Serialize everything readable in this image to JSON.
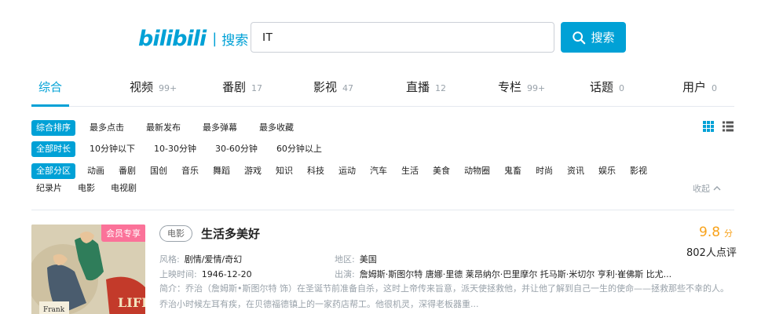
{
  "header": {
    "logo_mark": "bilibili",
    "logo_text": "搜索",
    "search_value": "IT",
    "search_button": "搜索"
  },
  "tabs": [
    {
      "label": "综合",
      "count": ""
    },
    {
      "label": "视频",
      "count": "99+"
    },
    {
      "label": "番剧",
      "count": "17"
    },
    {
      "label": "影视",
      "count": "47"
    },
    {
      "label": "直播",
      "count": "12"
    },
    {
      "label": "专栏",
      "count": "99+"
    },
    {
      "label": "话题",
      "count": "0"
    },
    {
      "label": "用户",
      "count": "0"
    }
  ],
  "filters": {
    "sort": [
      "综合排序",
      "最多点击",
      "最新发布",
      "最多弹幕",
      "最多收藏"
    ],
    "duration": [
      "全部时长",
      "10分钟以下",
      "10-30分钟",
      "30-60分钟",
      "60分钟以上"
    ],
    "zone": [
      "全部分区",
      "动画",
      "番剧",
      "国创",
      "音乐",
      "舞蹈",
      "游戏",
      "知识",
      "科技",
      "运动",
      "汽车",
      "生活",
      "美食",
      "动物圈",
      "鬼畜",
      "时尚",
      "资讯",
      "娱乐",
      "影视"
    ],
    "zone_row2": [
      "纪录片",
      "电影",
      "电视剧"
    ],
    "collapse_label": "收起"
  },
  "result": {
    "vip_badge": "会员专享",
    "type_tag": "电影",
    "title": "生活多美好",
    "score": "9.8",
    "score_unit": "分",
    "reviews": "802人点评",
    "style_key": "风格:",
    "style_val": "剧情/爱情/奇幻",
    "region_key": "地区:",
    "region_val": "美国",
    "date_key": "上映时间:",
    "date_val": "1946-12-20",
    "cast_key": "出演:",
    "cast_val": "詹姆斯·斯图尔特 唐娜·里德 莱昂纳尔·巴里摩尔 托马斯·米切尔 亨利·崔佛斯 比尤...",
    "desc": "简介：乔治（詹姆斯•斯图尔特 饰）在圣诞节前准备自杀，这时上帝传来旨意，派天使拯救他，并让他了解到自己一生的使命——拯救那些不幸的人。乔治小时候左耳有疾，在贝德福德镇上的一家药店帮工。他很机灵，深得老板器重..."
  },
  "colors": {
    "accent": "#00a1d6",
    "pink": "#fb7299",
    "score": "#f8a21a",
    "muted": "#99a2aa"
  }
}
